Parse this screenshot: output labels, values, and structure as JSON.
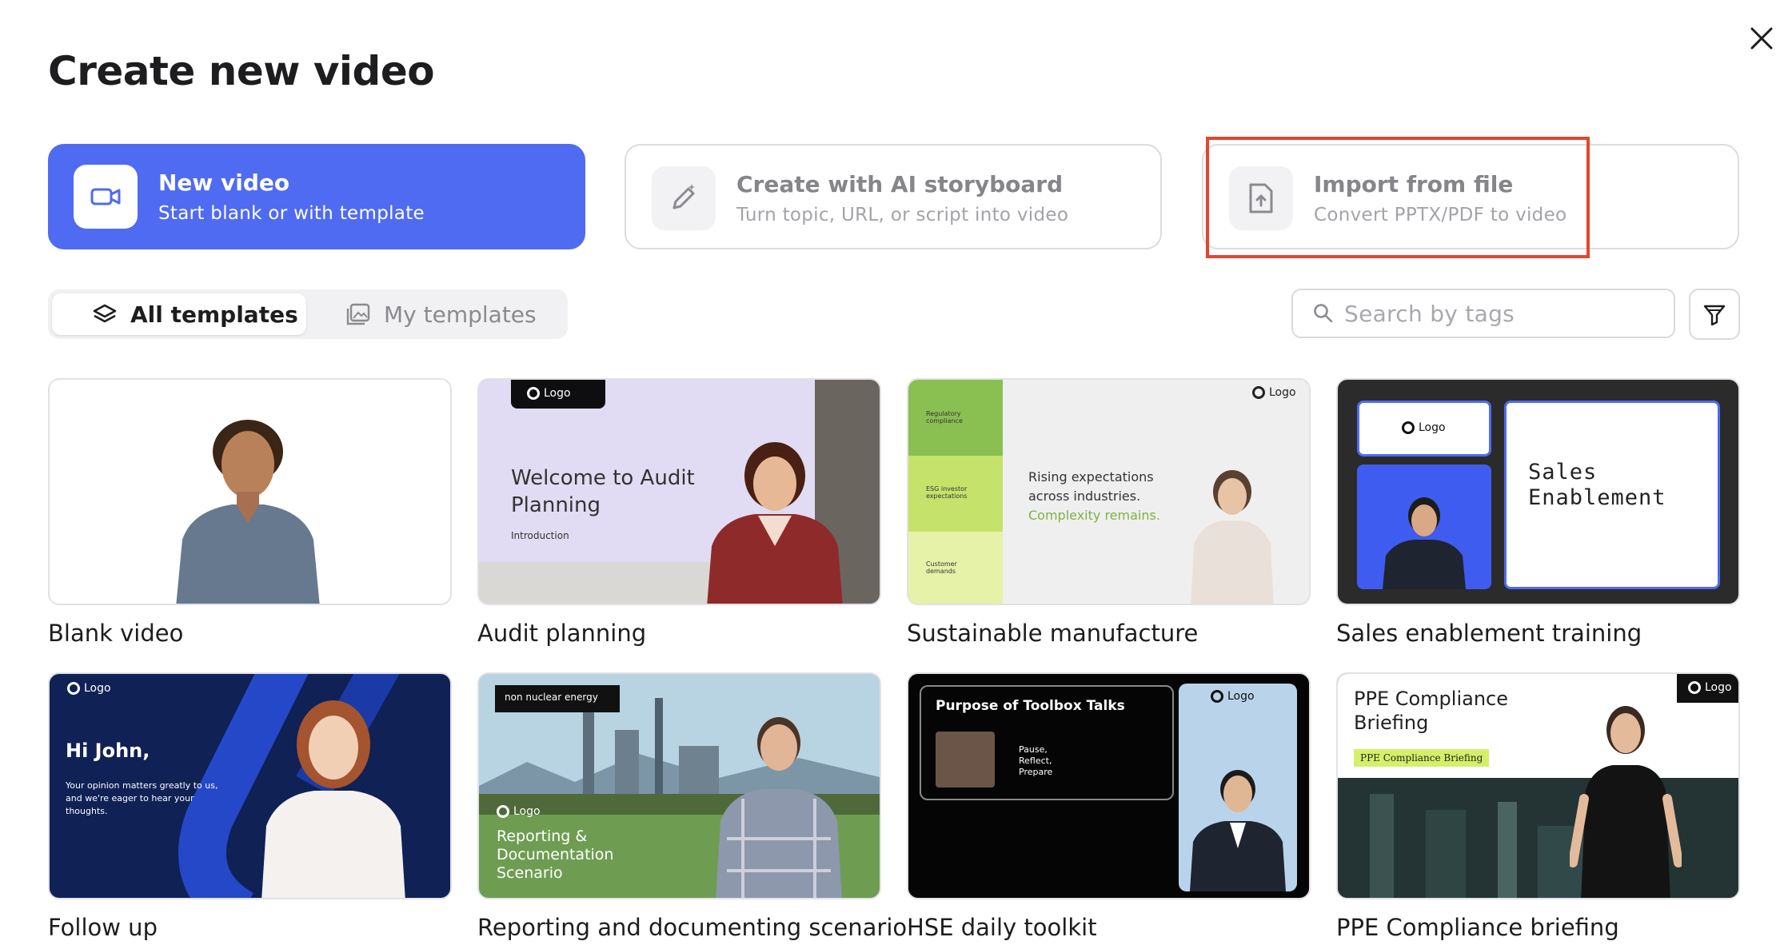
{
  "title": "Create new video",
  "options": [
    {
      "title": "New video",
      "subtitle": "Start blank or with template",
      "icon": "video-camera-icon"
    },
    {
      "title": "Create with AI storyboard",
      "subtitle": "Turn topic, URL, or script into video",
      "icon": "sparkle-pen-icon"
    },
    {
      "title": "Import from file",
      "subtitle": "Convert PPTX/PDF to video",
      "icon": "file-upload-icon"
    }
  ],
  "tabs": [
    {
      "label": "All templates",
      "icon": "layers-icon",
      "active": true
    },
    {
      "label": "My templates",
      "icon": "image-gallery-icon",
      "active": false
    }
  ],
  "search": {
    "placeholder": "Search by tags"
  },
  "logo_text": "Logo",
  "templates": [
    {
      "label": "Blank video"
    },
    {
      "label": "Audit planning",
      "heading": "Welcome to Audit Planning",
      "sub": "Introduction"
    },
    {
      "label": "Sustainable manufacture",
      "side": [
        "Regulatory compliance",
        "ESG investor expectations",
        "Customer demands"
      ],
      "line1": "Rising expectations across industries.",
      "line2": "Complexity remains."
    },
    {
      "label": "Sales enablement training",
      "heading": "Sales Enablement"
    },
    {
      "label": "Follow up",
      "heading": "Hi John,",
      "body": "Your opinion matters greatly to us, and we're eager to hear your thoughts."
    },
    {
      "label": "Reporting and documenting scenario",
      "tag": "non nuclear energy",
      "heading": "Reporting & Documentation Scenario"
    },
    {
      "label": "HSE daily toolkit",
      "heading": "Purpose of Toolbox Talks",
      "steps": "Pause, Reflect, Prepare"
    },
    {
      "label": "PPE Compliance briefing",
      "heading": "PPE Compliance Briefing",
      "tag": "PPE Compliance Briefing"
    }
  ],
  "colors": {
    "accent": "#4f6bf2",
    "highlight": "#e2462f"
  }
}
